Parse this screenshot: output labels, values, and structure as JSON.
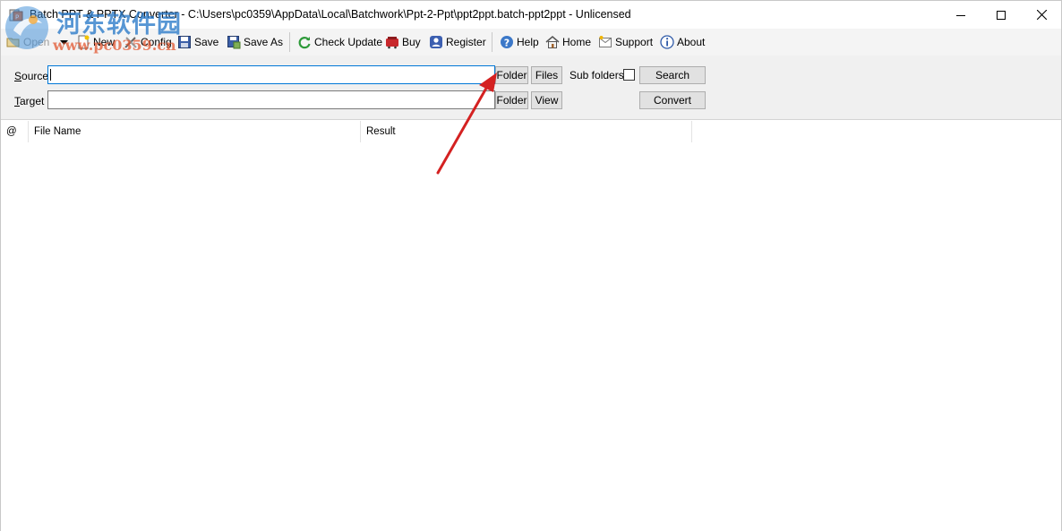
{
  "window": {
    "title": "Batch PPT & PPTX Converter - C:\\Users\\pc0359\\AppData\\Local\\Batchwork\\Ppt-2-Ppt\\ppt2ppt.batch-ppt2ppt - Unlicensed"
  },
  "watermark": {
    "name": "河东软件园",
    "url": "www.pc0359.cn"
  },
  "toolbar": {
    "open": "Open",
    "new": "New",
    "config": "Config",
    "save": "Save",
    "save_as": "Save As",
    "check_update": "Check Update",
    "buy": "Buy",
    "register": "Register",
    "help": "Help",
    "home": "Home",
    "support": "Support",
    "about": "About"
  },
  "source": {
    "label_hot": "S",
    "label_rest": "ource",
    "value": "",
    "folder_button": "Folder",
    "files_button": "Files",
    "subfolders_label": "Sub folders",
    "subfolders_checked": false,
    "search_button": "Search"
  },
  "target": {
    "label_hot": "T",
    "label_rest": "arget",
    "value": "",
    "folder_button": "Folder",
    "view_button": "View",
    "convert_button": "Convert"
  },
  "grid": {
    "columns": [
      "@",
      "File Name",
      "Result"
    ],
    "rows": []
  },
  "icons": {
    "open": "folder-open-icon",
    "new": "new-document-icon",
    "config": "tools-icon",
    "save": "floppy-disk-icon",
    "save_as": "floppy-disk-as-icon",
    "check_update": "refresh-icon",
    "buy": "cart-icon",
    "register": "user-badge-icon",
    "help": "help-icon",
    "home": "house-icon",
    "support": "support-icon",
    "about": "info-icon"
  },
  "colors": {
    "annotation_arrow": "#d42121",
    "focus_border": "#0078d7",
    "panel_bg": "#f0f0f0"
  }
}
